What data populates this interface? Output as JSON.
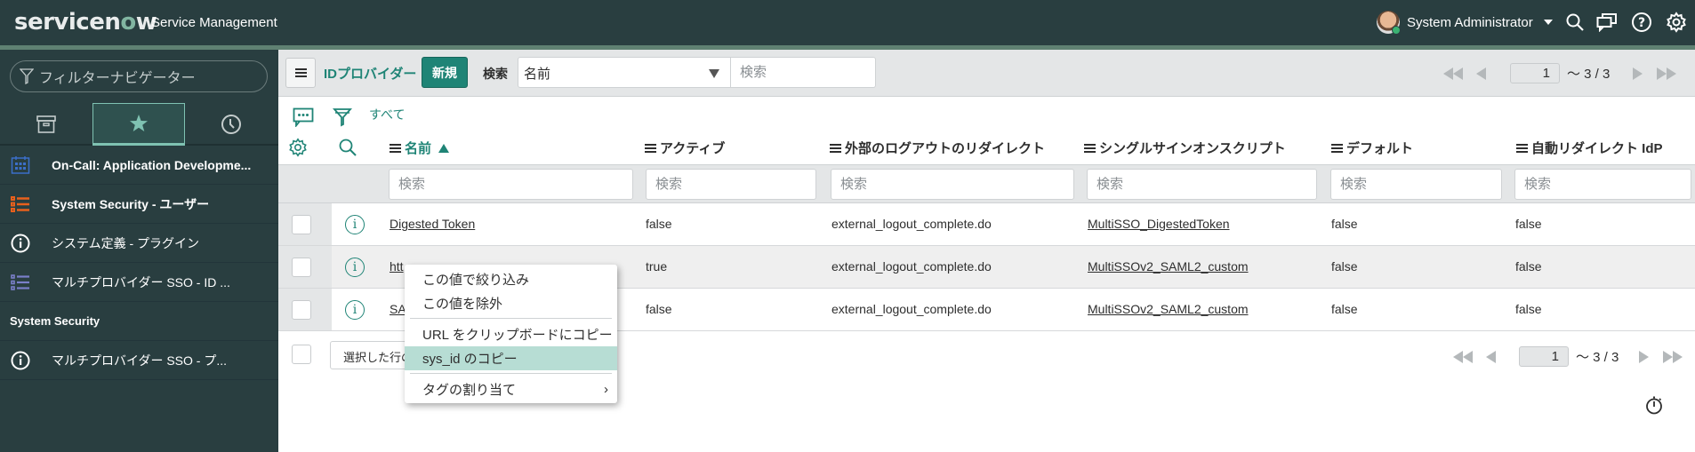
{
  "header": {
    "logo_text_a": "servicen",
    "logo_text_o": "o",
    "logo_text_b": "w",
    "product": "Service Management",
    "user_name": "System Administrator",
    "icons": [
      "search-icon",
      "chat-icon",
      "help-icon",
      "gear-icon"
    ]
  },
  "sidebar": {
    "filter_placeholder": "フィルターナビゲーター",
    "tabs": [
      {
        "name": "all-apps",
        "icon": "archive-icon",
        "active": false
      },
      {
        "name": "favorites",
        "icon": "star-icon",
        "active": true
      },
      {
        "name": "history",
        "icon": "clock-icon",
        "active": false
      }
    ],
    "items": [
      {
        "label": "On-Call: Application Developme...",
        "icon": "calendar-icon",
        "color": "#3b6fc9"
      },
      {
        "label": "System Security - ユーザー",
        "icon": "list-icon",
        "color": "#e8601c"
      },
      {
        "label": "システム定義 - プラグイン",
        "icon": "info-icon",
        "color": "#ffffff"
      },
      {
        "label": "マルチプロバイダー SSO - ID ...",
        "icon": "list-icon",
        "color": "#7a7fc9"
      },
      {
        "label": "System Security",
        "section": true
      },
      {
        "label": "マルチプロバイダー SSO - プ...",
        "icon": "info-icon",
        "color": "#ffffff"
      }
    ]
  },
  "listbar": {
    "title": "IDプロバイダー",
    "new_label": "新規",
    "search_label": "検索",
    "search_field": "名前",
    "search_placeholder": "検索",
    "page": "1",
    "range": "〜 3 / 3"
  },
  "tools": {
    "all_label": "すべて"
  },
  "columns": [
    {
      "label": "名前",
      "sorted": "asc"
    },
    {
      "label": "アクティブ"
    },
    {
      "label": "外部のログアウトのリダイレクト"
    },
    {
      "label": "シングルサインオンスクリプト"
    },
    {
      "label": "デフォルト"
    },
    {
      "label": "自動リダイレクト IdP"
    }
  ],
  "column_search_placeholder": "検索",
  "rows": [
    {
      "name": "Digested Token",
      "active": "false",
      "logout_redirect": "external_logout_complete.do",
      "sso_script": "MultiSSO_DigestedToken",
      "default": "false",
      "auto_redirect": "false"
    },
    {
      "name": "htt",
      "active": "true",
      "logout_redirect": "external_logout_complete.do",
      "sso_script": "MultiSSOv2_SAML2_custom",
      "default": "false",
      "auto_redirect": "false"
    },
    {
      "name": "SA",
      "active": "false",
      "logout_redirect": "external_logout_complete.do",
      "sso_script": "MultiSSOv2_SAML2_custom",
      "default": "false",
      "auto_redirect": "false"
    }
  ],
  "footer": {
    "action_label": "選択した行の",
    "page": "1",
    "range": "〜 3 / 3"
  },
  "context_menu": {
    "items": [
      {
        "label": "この値で絞り込み"
      },
      {
        "label": "この値を除外"
      },
      {
        "separator": true
      },
      {
        "label": "URL をクリップボードにコピー"
      },
      {
        "label": "sys_id のコピー",
        "highlighted": true
      },
      {
        "separator": true
      },
      {
        "label": "タグの割り当て",
        "submenu": true
      }
    ]
  },
  "colors": {
    "header_bg": "#293e40",
    "accent": "#1f8476",
    "highlight": "#b7ddd4"
  }
}
